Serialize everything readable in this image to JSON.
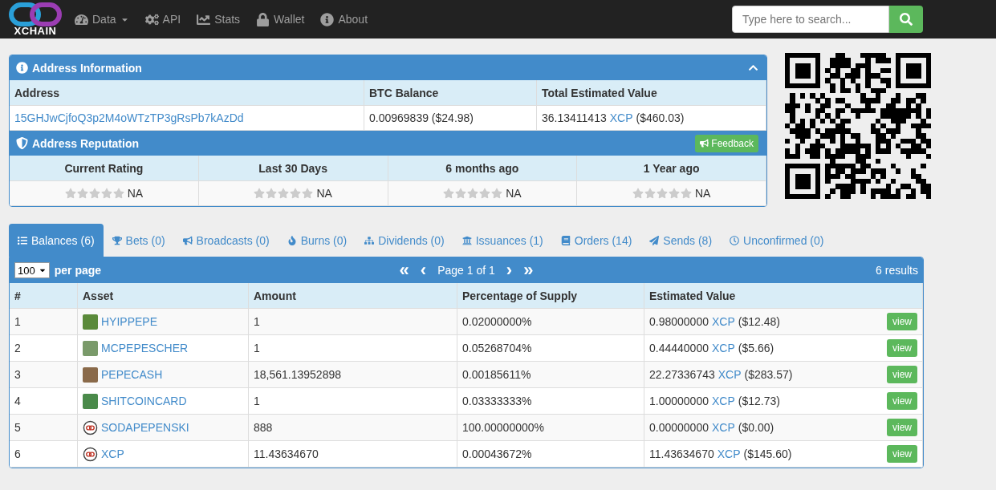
{
  "navbar": {
    "brand": "XCHAIN",
    "menu": [
      {
        "label": "Data"
      },
      {
        "label": "API"
      },
      {
        "label": "Stats"
      },
      {
        "label": "Wallet"
      },
      {
        "label": "About"
      }
    ],
    "search": {
      "placeholder": "Type here to search..."
    }
  },
  "address_panel": {
    "title": "Address Information",
    "columns": [
      "Address",
      "BTC Balance",
      "Total Estimated Value"
    ],
    "address": "15GHJwCjfoQ3p2M4oWTzTP3gRsPb7kAzDd",
    "btc_balance": "0.00969839 ($24.98)",
    "total_value": {
      "amount": "36.13411413",
      "unit": "XCP",
      "usd": "($460.03)"
    }
  },
  "reputation_panel": {
    "title": "Address Reputation",
    "feedback_button": "Feedback",
    "ratings": [
      {
        "label": "Current Rating",
        "stars": 0,
        "value": "NA"
      },
      {
        "label": "Last 30 Days",
        "stars": 0,
        "value": "NA"
      },
      {
        "label": "6 months ago",
        "stars": 0,
        "value": "NA"
      },
      {
        "label": "1 Year ago",
        "stars": 0,
        "value": "NA"
      }
    ]
  },
  "tabs": [
    {
      "label": "Balances (6)",
      "selected": true
    },
    {
      "label": "Bets (0)",
      "selected": false
    },
    {
      "label": "Broadcasts (0)",
      "selected": false
    },
    {
      "label": "Burns (0)",
      "selected": false
    },
    {
      "label": "Dividends (0)",
      "selected": false
    },
    {
      "label": "Issuances (1)",
      "selected": false
    },
    {
      "label": "Orders (14)",
      "selected": false
    },
    {
      "label": "Sends (8)",
      "selected": false
    },
    {
      "label": "Unconfirmed (0)",
      "selected": false
    }
  ],
  "balances": {
    "per_page_value": "100",
    "per_page_label": "per page",
    "pager": {
      "first": "«",
      "prev": "‹",
      "page": "Page 1 of 1",
      "next": "›",
      "last": "»"
    },
    "results": "6 results",
    "columns": [
      "#",
      "Asset",
      "Amount",
      "Percentage of Supply",
      "Estimated Value"
    ],
    "rows": [
      {
        "index": "1",
        "asset": "HYIPPEPE",
        "kind": "image",
        "amount": "1",
        "percentage": "0.02000000%",
        "value": {
          "amount": "0.98000000",
          "unit": "XCP",
          "usd": "($12.48)"
        },
        "action": "view"
      },
      {
        "index": "2",
        "asset": "MCPEPESCHER",
        "kind": "image",
        "amount": "1",
        "percentage": "0.05268704%",
        "value": {
          "amount": "0.44440000",
          "unit": "XCP",
          "usd": "($5.66)"
        },
        "action": "view"
      },
      {
        "index": "3",
        "asset": "PEPECASH",
        "kind": "image",
        "amount": "18,561.13952898",
        "percentage": "0.00185611%",
        "value": {
          "amount": "22.27336743",
          "unit": "XCP",
          "usd": "($283.57)"
        },
        "action": "view"
      },
      {
        "index": "4",
        "asset": "SHITCOINCARD",
        "kind": "image",
        "amount": "1",
        "percentage": "0.03333333%",
        "value": {
          "amount": "1.00000000",
          "unit": "XCP",
          "usd": "($12.73)"
        },
        "action": "view"
      },
      {
        "index": "5",
        "asset": "SODAPEPENSKI",
        "kind": "logo",
        "amount": "888",
        "percentage": "100.00000000%",
        "value": {
          "amount": "0.00000000",
          "unit": "XCP",
          "usd": "($0.00)"
        },
        "action": "view"
      },
      {
        "index": "6",
        "asset": "XCP",
        "kind": "logo",
        "amount": "11.43634670",
        "percentage": "0.00043672%",
        "value": {
          "amount": "11.43634670",
          "unit": "XCP",
          "usd": "($145.60)"
        },
        "action": "view"
      }
    ]
  }
}
